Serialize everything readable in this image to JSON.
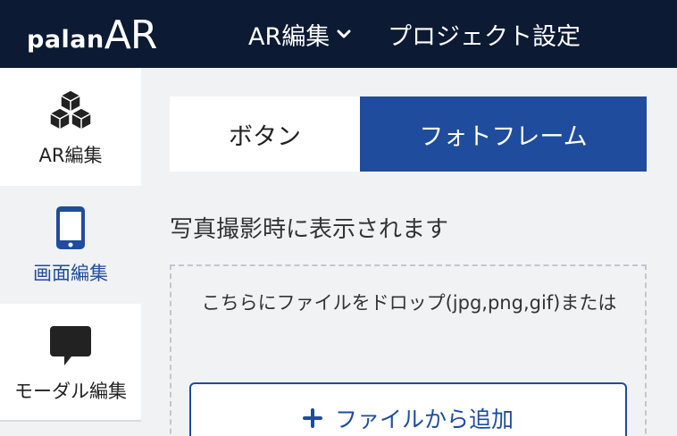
{
  "header": {
    "logo_small": "palan",
    "logo_big": "AR",
    "nav_ar_edit": "AR編集",
    "nav_project_settings": "プロジェクト設定"
  },
  "sidebar": {
    "items": [
      {
        "label": "AR編集",
        "icon": "cubes-icon"
      },
      {
        "label": "画面編集",
        "icon": "smartphone-icon",
        "active": true
      },
      {
        "label": "モーダル編集",
        "icon": "speech-bubble-icon"
      }
    ]
  },
  "tabs": [
    {
      "label": "ボタン"
    },
    {
      "label": "フォトフレーム",
      "active": true
    }
  ],
  "main": {
    "description": "写真撮影時に表示されます",
    "drop_text": "こちらにファイルをドロップ(jpg,png,gif)または",
    "add_button": "ファイルから追加"
  },
  "colors": {
    "header_bg": "#0c1a33",
    "accent": "#1f4c9c",
    "page_bg": "#f1f2f4"
  }
}
